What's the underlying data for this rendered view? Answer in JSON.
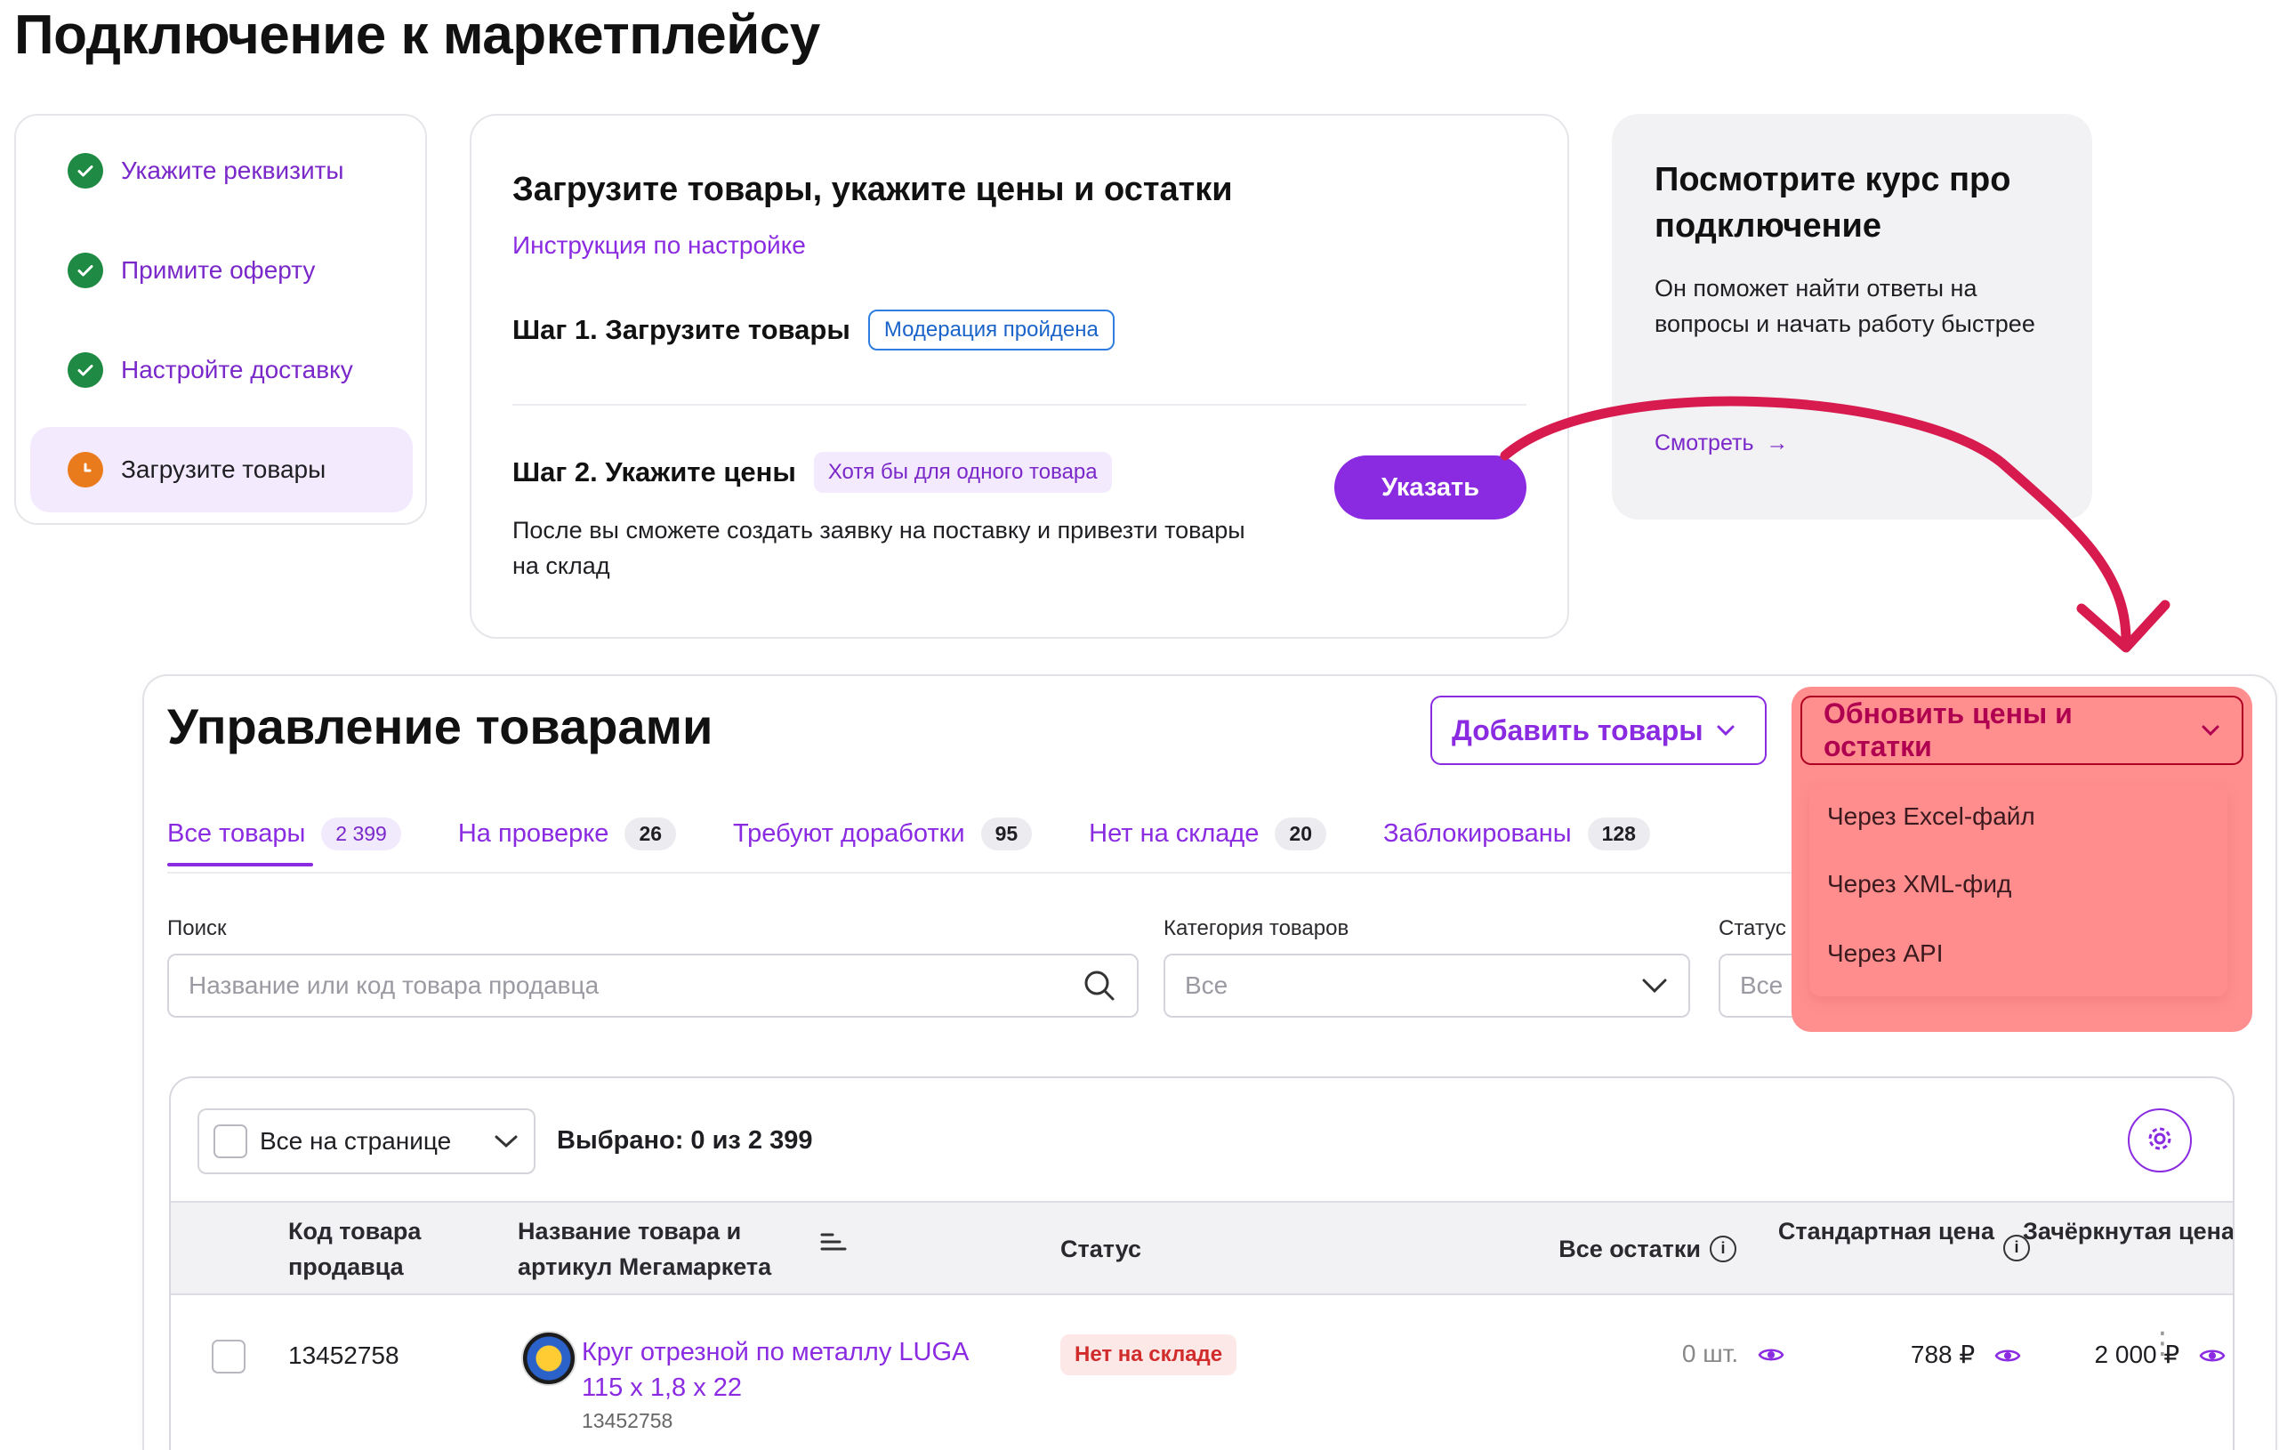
{
  "page_title": "Подключение к маркетплейсу",
  "steps": [
    {
      "label": "Укажите реквизиты",
      "state": "done"
    },
    {
      "label": "Примите оферту",
      "state": "done"
    },
    {
      "label": "Настройте доставку",
      "state": "done"
    },
    {
      "label": "Загрузите товары",
      "state": "current"
    }
  ],
  "upload": {
    "title": "Загрузите товары, укажите цены и остатки",
    "instruction_link": "Инструкция по настройке",
    "step1_title": "Шаг 1. Загрузите товары",
    "step1_badge": "Модерация пройдена",
    "step2_title": "Шаг 2. Укажите цены",
    "step2_badge": "Хотя бы для одного товара",
    "step2_desc": "После вы сможете создать заявку на поставку и привезти товары на склад",
    "specify_button": "Указать"
  },
  "course": {
    "title": "Посмотрите курс про подключение",
    "desc": "Он поможет найти ответы на вопросы и начать работу быстрее",
    "link": "Смотреть"
  },
  "management": {
    "title": "Управление товарами",
    "add_button": "Добавить товары",
    "update_button": "Обновить цены и остатки",
    "update_menu": [
      "Через Excel-файл",
      "Через XML-фид",
      "Через API"
    ],
    "tabs": [
      {
        "label": "Все товары",
        "count": "2 399"
      },
      {
        "label": "На проверке",
        "count": "26"
      },
      {
        "label": "Требуют доработки",
        "count": "95"
      },
      {
        "label": "Нет на складе",
        "count": "20"
      },
      {
        "label": "Заблокированы",
        "count": "128"
      }
    ],
    "filters": {
      "search_label": "Поиск",
      "search_placeholder": "Название или код товара продавца",
      "category_label": "Категория товаров",
      "category_value": "Все",
      "status_label": "Статус т",
      "status_value": "Все"
    },
    "table": {
      "select_label": "Все на странице",
      "selected_text": "Выбрано: 0 из 2 399",
      "headers": {
        "code": "Код товара продавца",
        "name": "Название товара и артикул Мегамаркета",
        "status": "Статус",
        "stock": "Все остатки",
        "price": "Стандартная цена",
        "crossed_price": "Зачёркнутая цена"
      },
      "rows": [
        {
          "code": "13452758",
          "name": "Круг отрезной по металлу LUGA 115 х 1,8 х 22",
          "sku": "13452758",
          "status": "Нет на складе",
          "stock": "0 шт.",
          "price": "788 ₽",
          "crossed_price": "2 000 ₽"
        }
      ]
    }
  },
  "colors": {
    "accent": "#8a2be2",
    "done": "#1e8a44",
    "pending": "#ea7b1c",
    "highlight": "#ff8f8f",
    "arrow": "#d81b4f"
  }
}
